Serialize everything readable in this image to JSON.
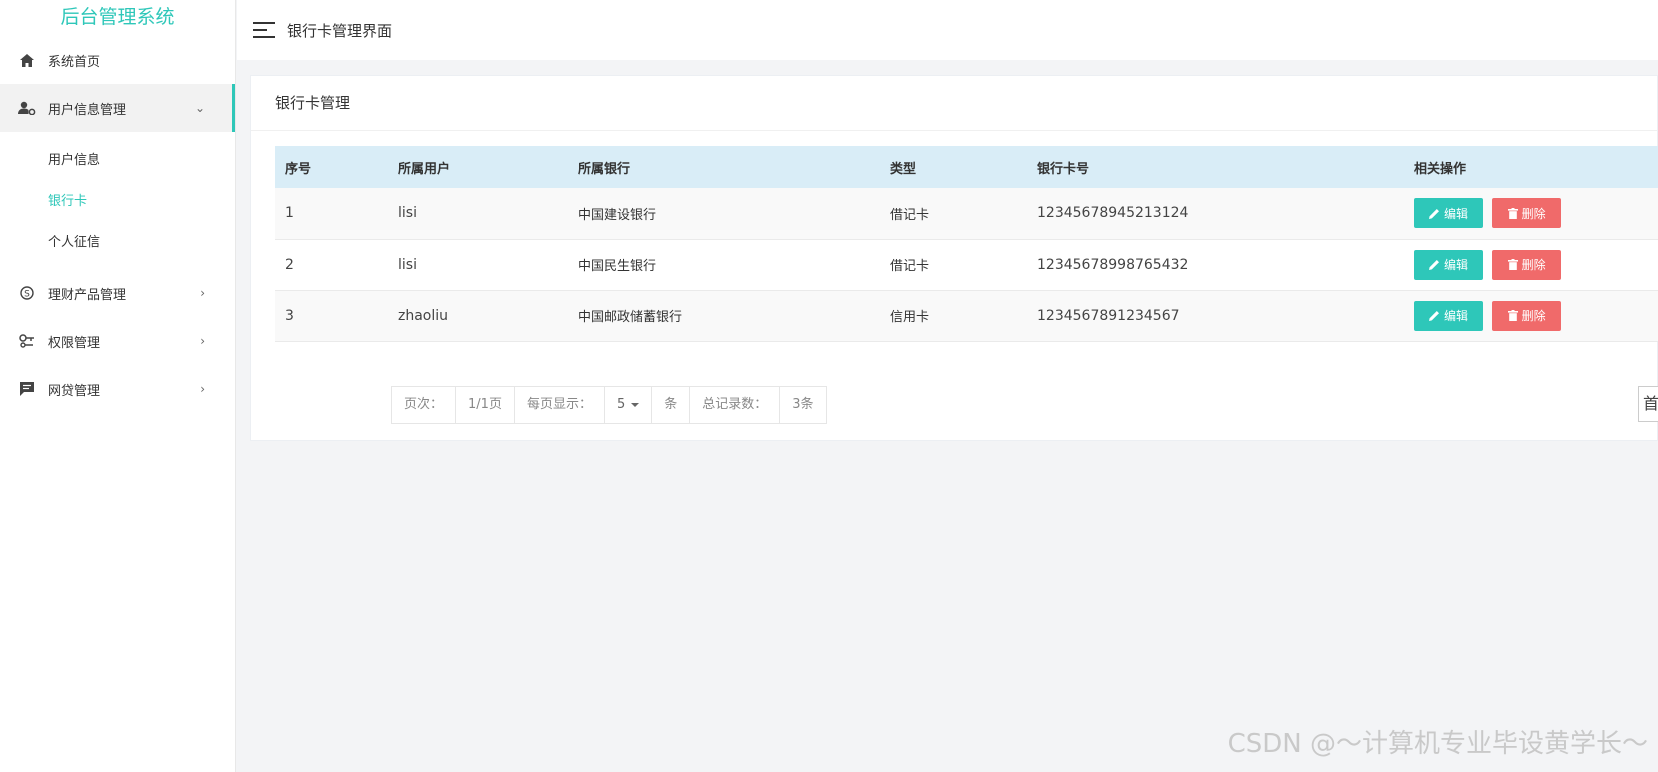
{
  "app_title": "后台管理系统",
  "topbar": {
    "title": "银行卡管理界面"
  },
  "sidebar": {
    "items": [
      {
        "label": "系统首页",
        "icon": "home-icon"
      },
      {
        "label": "用户信息管理",
        "icon": "user-settings-icon",
        "arrow": "⌄"
      },
      {
        "label": "理财产品管理",
        "icon": "finance-icon",
        "arrow": "›"
      },
      {
        "label": "权限管理",
        "icon": "key-icon",
        "arrow": "›"
      },
      {
        "label": "网贷管理",
        "icon": "chat-icon",
        "arrow": "›"
      }
    ],
    "subitems": [
      "用户信息",
      "银行卡",
      "个人征信"
    ]
  },
  "card": {
    "title": "银行卡管理"
  },
  "table": {
    "headers": [
      "序号",
      "所属用户",
      "所属银行",
      "类型",
      "银行卡号",
      "相关操作"
    ],
    "rows": [
      [
        "1",
        "lisi",
        "中国建设银行",
        "借记卡",
        "12345678945213124"
      ],
      [
        "2",
        "lisi",
        "中国民生银行",
        "借记卡",
        "12345678998765432"
      ],
      [
        "3",
        "zhaoliu",
        "中国邮政储蓄银行",
        "信用卡",
        "1234567891234567"
      ]
    ],
    "edit_label": "编辑",
    "delete_label": "删除"
  },
  "pager": {
    "page_label": "页次：",
    "page_value": "1/1页",
    "per_page_label": "每页显示：",
    "per_page_value": "5",
    "unit": "条",
    "total_label": "总记录数：",
    "total_value": "3条",
    "first_label": "首页"
  },
  "watermark": "CSDN @～计算机专业毕设黄学长～",
  "colors": {
    "accent": "#2ec7b9",
    "danger": "#f06a6a",
    "table_header": "#d9edf7"
  }
}
